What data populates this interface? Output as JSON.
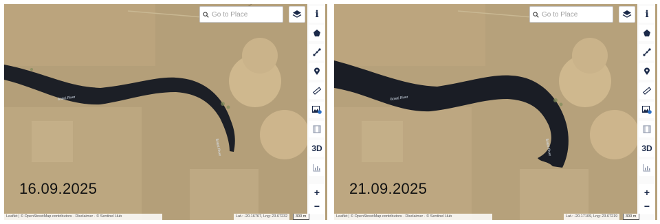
{
  "panels": [
    {
      "search_placeholder": "Go to Place",
      "date": "16.09.2025",
      "attribution": "Leaflet | © OpenStreetMap contributors · Disclaimer · © Sentinel Hub",
      "coords": "Lat.: -20.16767, Lng: 23.67232",
      "scale": "300 m",
      "river_labels": [
        "Boteti River",
        "Boteti River"
      ]
    },
    {
      "search_placeholder": "Go to Place",
      "date": "21.09.2025",
      "attribution": "Leaflet | © OpenStreetMap contributors · Disclaimer · © Sentinel Hub",
      "coords": "Lat.: -20.17109, Lng: 23.67219",
      "scale": "300 m",
      "river_labels": [
        "Boteti River",
        "Boteti River"
      ]
    }
  ],
  "toolbar": {
    "info_label": "i",
    "three_d_label": "3D",
    "zoom_in_label": "+",
    "zoom_out_label": "−",
    "icons": [
      "polygon-icon",
      "line-icon",
      "marker-icon",
      "ruler-icon",
      "image-download-icon",
      "film-icon",
      "3d-button",
      "chart-icon"
    ]
  },
  "colors": {
    "terrain": "#b8a47f",
    "river": "#1c1f26",
    "fields": "#cdb48a",
    "toolbar_icon": "#1b2a4a"
  }
}
